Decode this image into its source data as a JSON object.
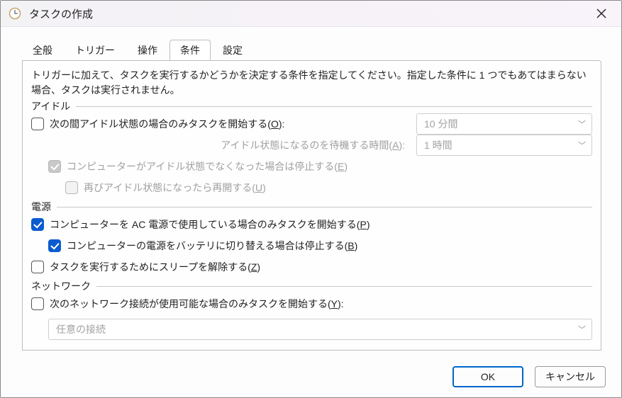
{
  "window": {
    "title": "タスクの作成"
  },
  "tabs": [
    "全般",
    "トリガー",
    "操作",
    "条件",
    "設定"
  ],
  "active_tab": 3,
  "desc": "トリガーに加えて、タスクを実行するかどうかを決定する条件を指定してください。指定した条件に 1 つでもあてはまらない場合、タスクは実行されません。",
  "group_idle": "アイドル",
  "idle_start": {
    "label": "次の間アイドル状態の場合のみタスクを開始する(",
    "key": "O",
    "tail": "):"
  },
  "idle_duration": "10 分間",
  "idle_wait_label": {
    "label": "アイドル状態になるのを待機する時間(",
    "key": "A",
    "tail": "):"
  },
  "idle_wait": "1 時間",
  "idle_stop": {
    "label": "コンピューターがアイドル状態でなくなった場合は停止する(",
    "key": "E",
    "tail": ")"
  },
  "idle_restart": {
    "label": "再びアイドル状態になったら再開する(",
    "key": "U",
    "tail": ")"
  },
  "group_power": "電源",
  "power_ac": {
    "label": "コンピューターを AC 電源で使用している場合のみタスクを開始する(",
    "key": "P",
    "tail": ")"
  },
  "power_bat": {
    "label": "コンピューターの電源をバッテリに切り替える場合は停止する(",
    "key": "B",
    "tail": ")"
  },
  "power_wake": {
    "label": "タスクを実行するためにスリープを解除する(",
    "key": "Z",
    "tail": ")"
  },
  "group_net": "ネットワーク",
  "net_start": {
    "label": "次のネットワーク接続が使用可能な場合のみタスクを開始する(",
    "key": "Y",
    "tail": "):"
  },
  "net_combo": "任意の接続",
  "buttons": {
    "ok": "OK",
    "cancel": "キャンセル"
  }
}
